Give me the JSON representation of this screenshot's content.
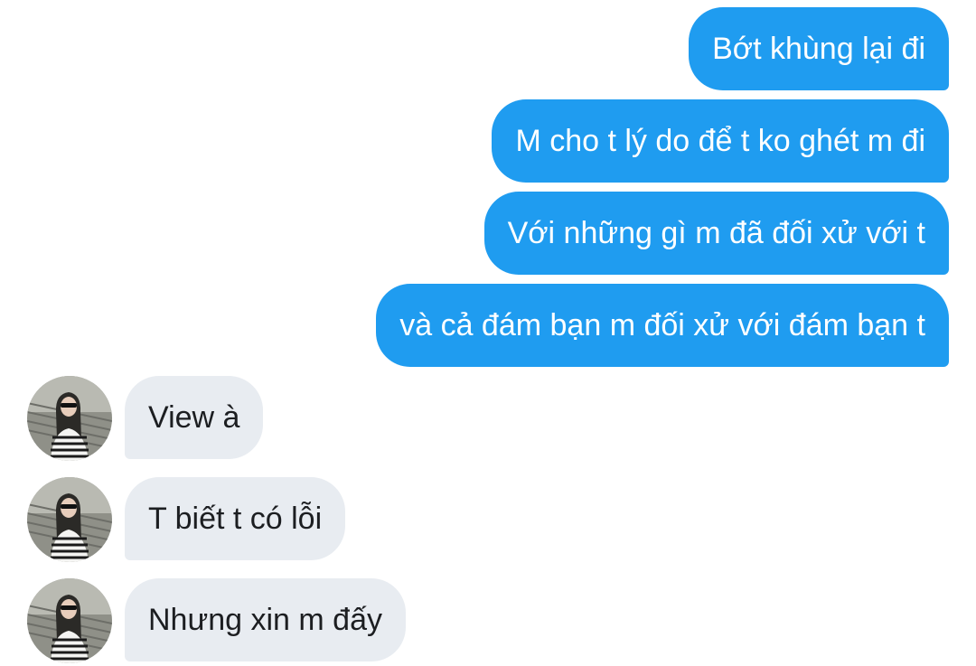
{
  "outgoing": [
    "Bớt khùng lại đi",
    "M cho t lý do để t ko ghét m đi",
    "Với những gì m đã đối xử với t ",
    "và cả đám bạn m đối xử với đám bạn t"
  ],
  "incoming": [
    "View à",
    "T biết t có lỗi",
    "Nhưng xin m đấy"
  ],
  "colors": {
    "outgoing_bubble": "#1f9cf0",
    "incoming_bubble": "#e8ecf1"
  }
}
